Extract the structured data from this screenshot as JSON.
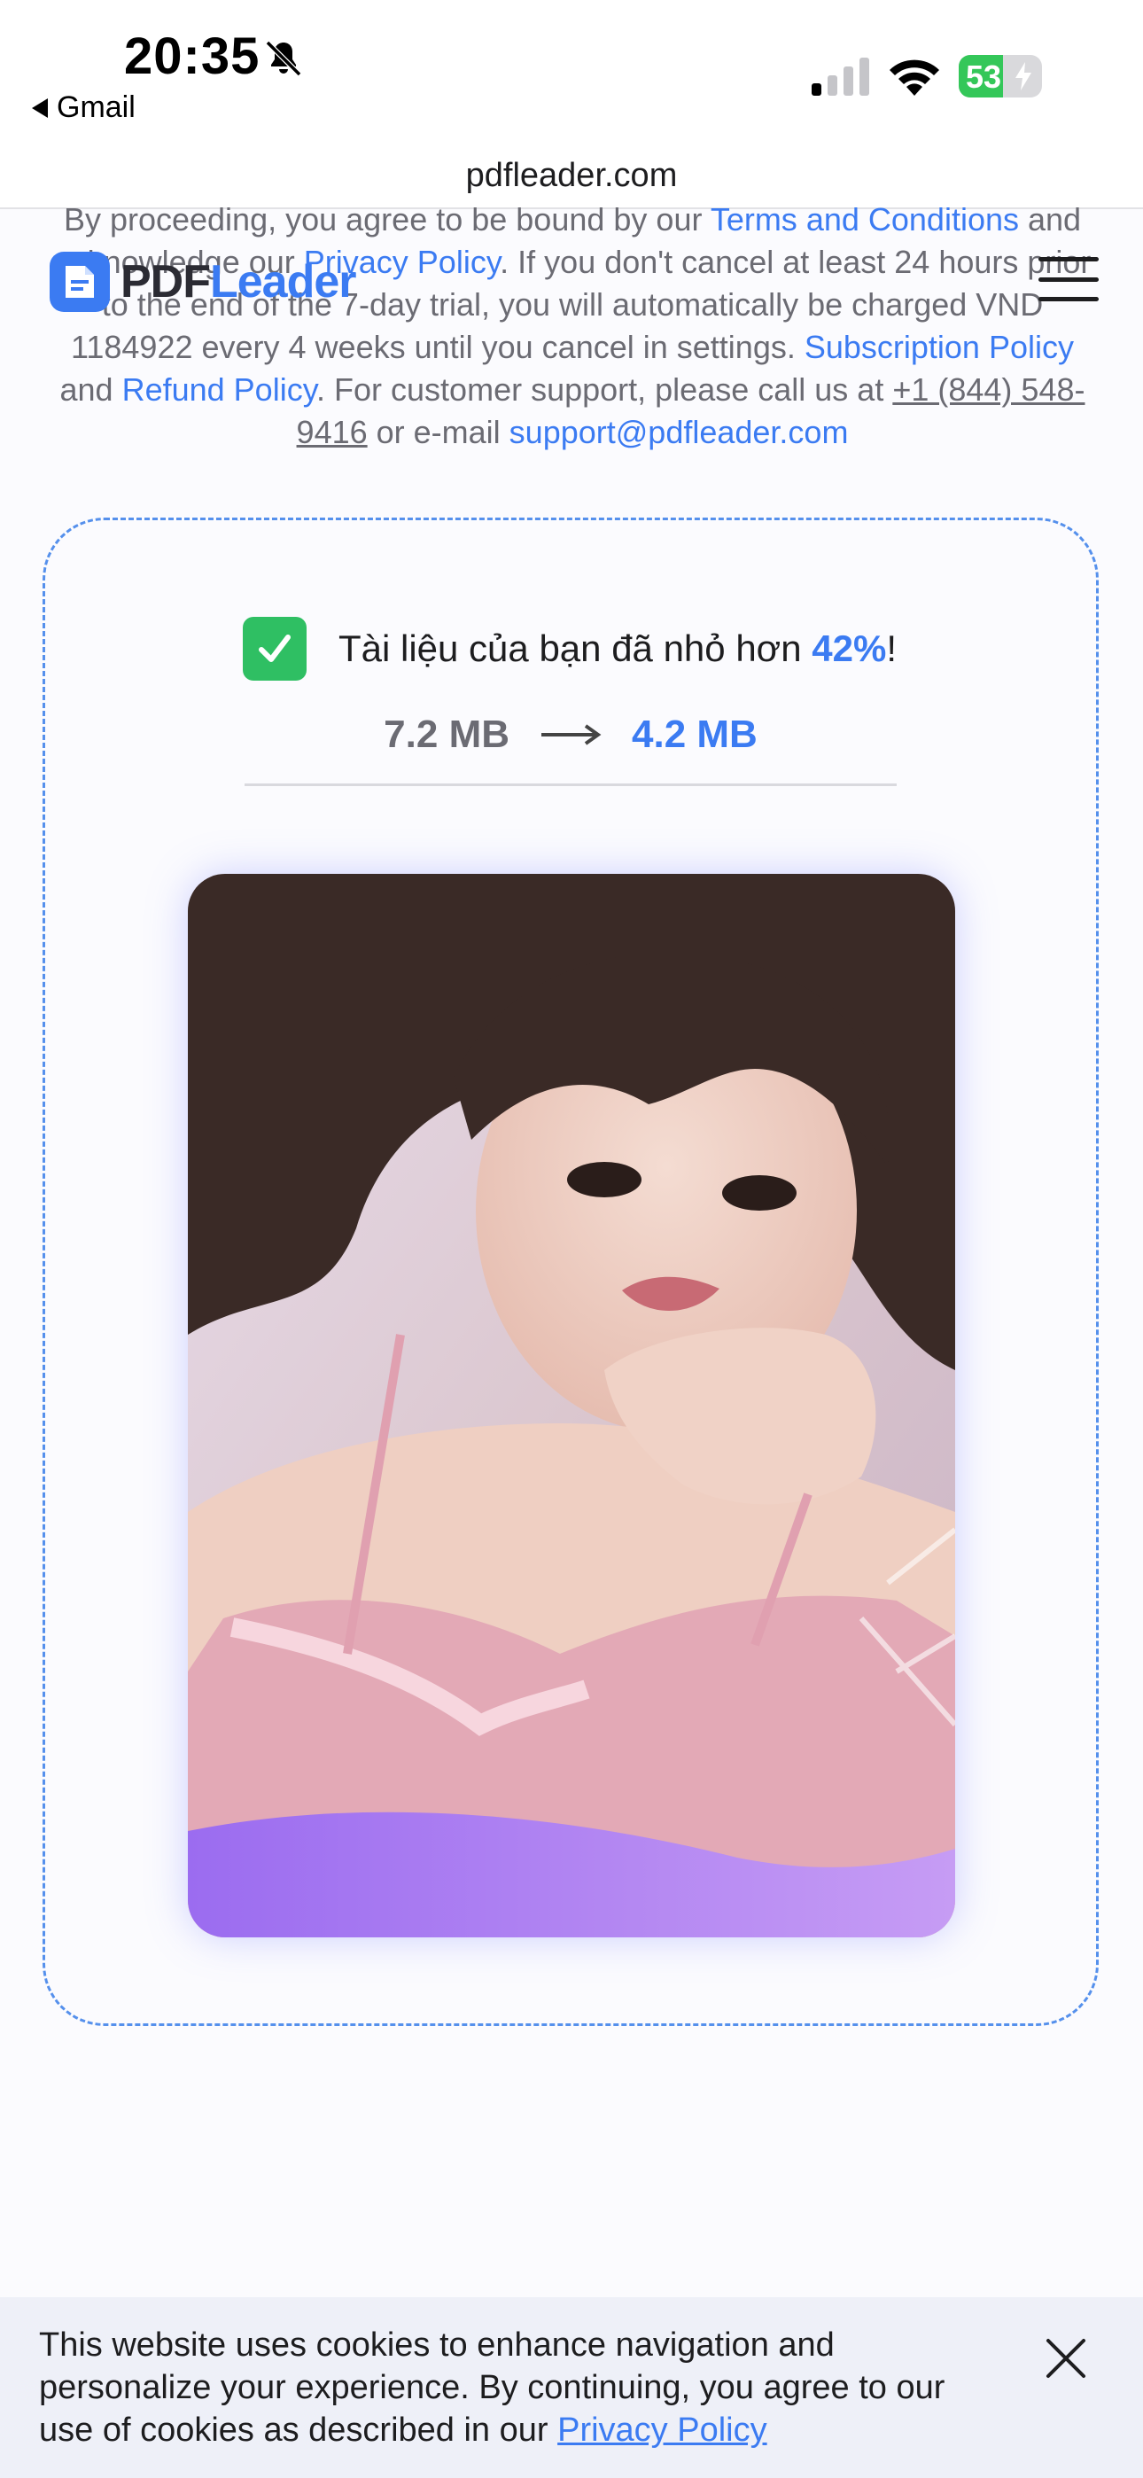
{
  "status_bar": {
    "time": "20:35",
    "back_app": "Gmail",
    "battery_level": "53",
    "battery_percent": 53,
    "icons": [
      "bell-slash-icon",
      "signal-icon",
      "wifi-icon",
      "battery-icon"
    ]
  },
  "browser": {
    "url": "pdfleader.com"
  },
  "header": {
    "logo_pdf": "PDF",
    "logo_leader": "Leader",
    "menu_icon": "hamburger-menu-icon"
  },
  "legal": {
    "t1": "By proceeding, you agree to be bound by our ",
    "terms_link": "Terms and Conditions",
    "t2": " and acknowledge our ",
    "privacy_link": "Privacy Policy",
    "t3": ". If you don't cancel at least 24 hours prior to the end of the 7-day trial, you will automatically be charged VND 1184922 every 4 weeks until you cancel in settings. ",
    "subscription_link": "Subscription Policy",
    "t4": " and ",
    "refund_link": "Refund Policy",
    "t5": ". For customer support, please call us at ",
    "phone": "+1 (844) 548-9416",
    "t6": " or e-mail ",
    "email": "support@pdfleader.com"
  },
  "result": {
    "message": "Tài liệu của bạn đã nhỏ hơn ",
    "percent": "42%",
    "suffix": "!",
    "size_before": "7.2 MB",
    "size_after": "4.2 MB",
    "check_icon": "checkmark-icon",
    "arrow_icon": "arrow-right-icon"
  },
  "cookie": {
    "text": "This website uses cookies to enhance navigation and personalize your experience. By continuing, you agree to our use of cookies as described in our ",
    "link": "Privacy Policy",
    "close_icon": "close-icon"
  },
  "colors": {
    "accent": "#3b7bf2",
    "success": "#2fbf63",
    "battery": "#34c759"
  }
}
